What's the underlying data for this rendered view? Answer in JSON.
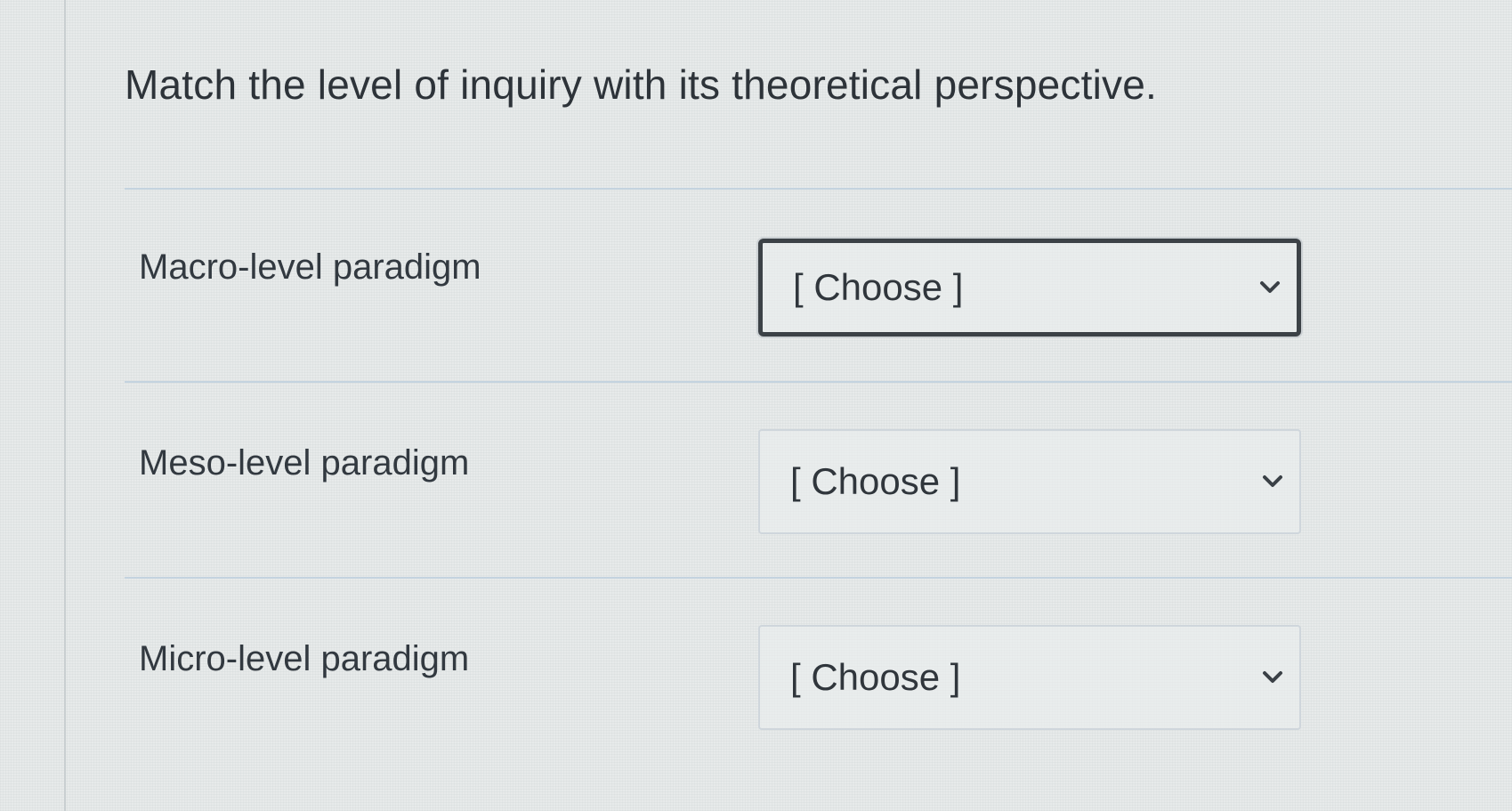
{
  "question": {
    "title": "Match the level of inquiry with its theoretical perspective."
  },
  "rows": [
    {
      "label": "Macro-level paradigm",
      "selected": "[ Choose ]"
    },
    {
      "label": "Meso-level paradigm",
      "selected": "[ Choose ]"
    },
    {
      "label": "Micro-level paradigm",
      "selected": "[ Choose ]"
    }
  ],
  "icons": {
    "dropdown": "chevron-down-icon"
  },
  "colors": {
    "text": "#2d3339",
    "focus_border": "#3c4247",
    "divider": "#c4d3df"
  }
}
